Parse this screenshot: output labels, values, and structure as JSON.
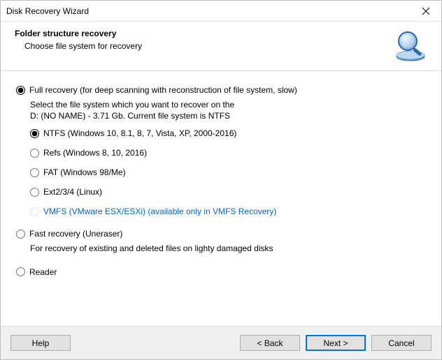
{
  "title": "Disk Recovery Wizard",
  "header": {
    "heading": "Folder structure recovery",
    "subheading": "Choose file system for recovery"
  },
  "modes": {
    "full": {
      "label": "Full recovery (for deep scanning with reconstruction of file system, slow)",
      "desc_line1": "Select the file system which you want to recover on the",
      "desc_line2": "D: (NO NAME) - 3.71 Gb. Current file system is NTFS",
      "selected": true
    },
    "fast": {
      "label": "Fast recovery (Uneraser)",
      "desc": "For recovery of existing and deleted files on lighty damaged disks",
      "selected": false
    },
    "reader": {
      "label": "Reader",
      "selected": false
    }
  },
  "filesystems": {
    "ntfs": {
      "label": "NTFS (Windows 10, 8.1, 8, 7, Vista, XP, 2000-2016)",
      "selected": true
    },
    "refs": {
      "label": "Refs (Windows 8, 10, 2016)",
      "selected": false
    },
    "fat": {
      "label": "FAT (Windows 98/Me)",
      "selected": false
    },
    "ext": {
      "label": "Ext2/3/4 (Linux)",
      "selected": false
    },
    "vmfs": {
      "label": "VMFS (VMware ESX/ESXi) (available only in VMFS Recovery)",
      "selected": false,
      "disabled": true
    }
  },
  "buttons": {
    "help": "Help",
    "back": "< Back",
    "next": "Next >",
    "cancel": "Cancel"
  }
}
